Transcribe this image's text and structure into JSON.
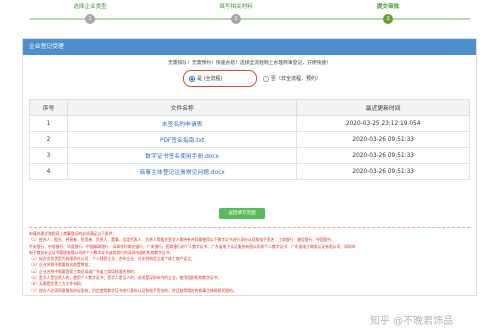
{
  "stepper": {
    "steps": [
      {
        "label": "选择企业类型",
        "number": "1",
        "state": "done"
      },
      {
        "label": "填写相关材料",
        "number": "2",
        "state": "done"
      },
      {
        "label": "提交审批",
        "number": "3",
        "state": "active"
      }
    ]
  },
  "panel": {
    "title": "企业登记受理",
    "notice": "无需排队！无需预约！快速办结！选择全流程网上办理商事登记，方便快捷！",
    "modes": [
      {
        "label": "是 (全流程)",
        "selected": true
      },
      {
        "label": "否（非全流程，预约）",
        "selected": false
      }
    ]
  },
  "table": {
    "headers": [
      "序号",
      "文件名称",
      "最近更新时间"
    ],
    "rows": [
      {
        "index": "1",
        "name": "未签名的申请表",
        "time": "2020-03-25 23:12:19.054"
      },
      {
        "index": "2",
        "name": "PDF签名指南.txt",
        "time": "2020-03-26 09:51:33"
      },
      {
        "index": "3",
        "name": "数字证书签名使用手册.docx",
        "time": "2020-03-26 09:51:33"
      },
      {
        "index": "4",
        "name": "商事主体登记注册常见问题.docx",
        "time": "2020-03-26 09:51:33"
      }
    ]
  },
  "fill_button": "返回填写页面",
  "notes": [
    "申请办理全流程网上商事登记的必须满足以下条件：",
    "（1）经办人、股东、经营者、投资者、负责人、董事、法定代表人、负责人等相关签字人需持有并同意使用以下数字证书进行身份认证和电子签名：工商银行、建设银行、中国银行、",
    "平安银行、中信银行、华夏银行、中国邮政银行、深圳农村商业银行、广发银行、招商银行的个人数字证书；广东省电子认证服务有限公司的个人数字证书；广东省电子商务认证有限公司、深圳市",
    "电子商务安全证书管理有限公司的个人数字证书或其发行的深圳市组织机构数字证书；",
    "（2）拟办业务类型为有限责任公司、个人独资企业、合伙企业、分支机构设立或个体工商户设立；",
    "（3）企业名称不需要核名前置审批；",
    "（4）企业名称中需要国家工商总局或广东省工商局核准名称的；",
    "（5）签字人是自然人的，使用个人数字证书；签字人是法人的，必须是深圳市内的企业，使用组织机构数字证书；",
    "（6）无需提交第三方文件材料；",
    "（7）经办人必须同意服务协议条款，约定使用数字证书进行身份认证和电子签名的，并且取得相应的商事主体授权代理的。"
  ],
  "watermark": "知乎 @不晚君饰品"
}
